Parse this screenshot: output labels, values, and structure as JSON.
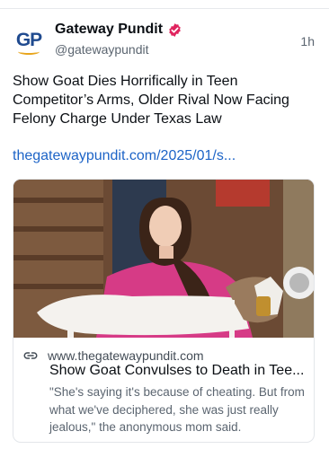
{
  "post": {
    "author_name": "Gateway Pundit",
    "author_handle": "@gatewaypundit",
    "avatar_text": "GP",
    "time": "1h",
    "text": "Show Goat Dies Horrifically in Teen Competitor’s Arms, Older Rival Now Facing Felony Charge Under Texas Law",
    "link": "thegatewaypundit.com/2025/01/s..."
  },
  "card": {
    "domain": "www.thegatewaypundit.com",
    "title": "Show Goat Convulses to Death in Tee...",
    "description": "\"She's saying it's because of cheating. But from what we've deciphered, she was just really jealous,\" the anonymous mom said."
  },
  "icons": {
    "verified": "verified-badge-icon",
    "link": "link-icon"
  },
  "colors": {
    "link": "#1d64c7",
    "verified": "#e0245e",
    "brand_blue": "#1f4a8f",
    "brand_orange": "#e8a51c"
  }
}
